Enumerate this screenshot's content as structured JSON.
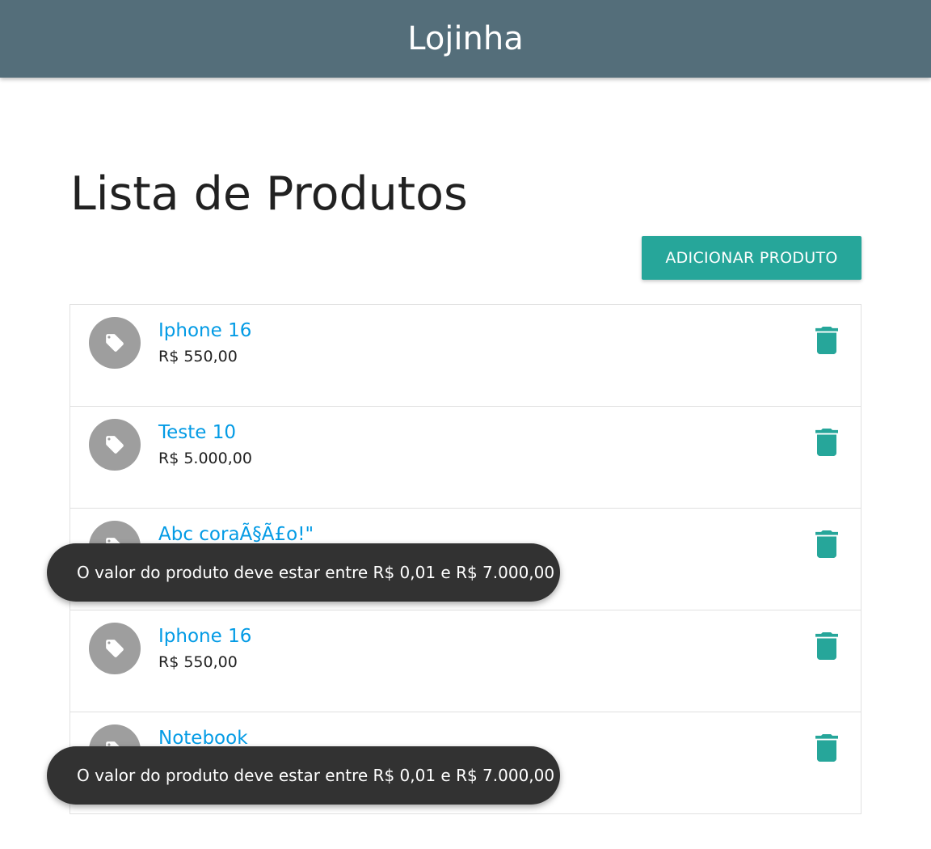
{
  "navbar": {
    "brand": "Lojinha"
  },
  "page": {
    "title": "Lista de Produtos"
  },
  "toolbar": {
    "add_label": "ADICIONAR PRODUTO"
  },
  "products": [
    {
      "name": "Iphone 16",
      "price": "R$ 550,00"
    },
    {
      "name": "Teste 10",
      "price": "R$ 5.000,00"
    },
    {
      "name": "Abc coraÃ§Ã£o!\"",
      "price": ""
    },
    {
      "name": "Iphone 16",
      "price": "R$ 550,00"
    },
    {
      "name": "Notebook",
      "price": ""
    }
  ],
  "toasts": [
    {
      "message": "O valor do produto deve estar entre R$ 0,01 e R$ 7.000,00"
    },
    {
      "message": "O valor do produto deve estar entre R$ 0,01 e R$ 7.000,00"
    }
  ],
  "colors": {
    "navbar": "#546e7a",
    "accent": "#26a69a",
    "link": "#039be5",
    "avatar": "#9e9e9e",
    "toast": "#323232"
  },
  "icons": {
    "item_icon": "label-tag-icon",
    "delete_icon": "delete-trash-icon"
  }
}
